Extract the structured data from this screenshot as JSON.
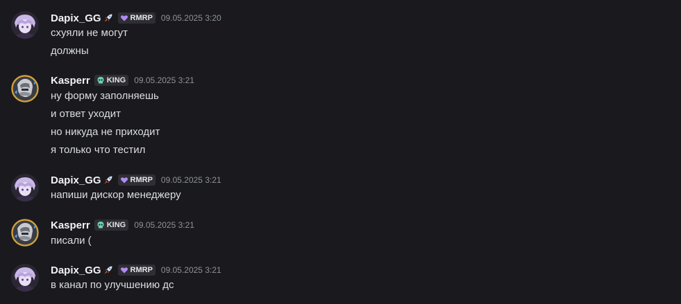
{
  "colors": {
    "background": "#1a1a1e",
    "username": "#f2f3f5",
    "message_text": "#dbdee1",
    "timestamp": "#8e9297",
    "tag_background": "#2e2e34",
    "rmrp_tag_icon": "#b08cf0",
    "king_tag_icon": "#6fd3b0"
  },
  "messages": [
    {
      "author": "Dapix_GG",
      "author_icon": "rocket-icon",
      "tag": "RMRP",
      "tag_icon": "purple-heart-icon",
      "timestamp": "09.05.2025 3:20",
      "lines": [
        "схуяли не могут",
        "должны"
      ]
    },
    {
      "author": "Kasperr",
      "tag": "KING",
      "tag_icon": "skull-icon",
      "timestamp": "09.05.2025 3:21",
      "lines": [
        "ну форму заполняешь",
        "и ответ уходит",
        "но никуда не приходит",
        "я только что тестил"
      ]
    },
    {
      "author": "Dapix_GG",
      "author_icon": "rocket-icon",
      "tag": "RMRP",
      "tag_icon": "purple-heart-icon",
      "timestamp": "09.05.2025 3:21",
      "lines": [
        "напиши дискор менеджеру"
      ]
    },
    {
      "author": "Kasperr",
      "tag": "KING",
      "tag_icon": "skull-icon",
      "timestamp": "09.05.2025 3:21",
      "lines": [
        "писали ("
      ]
    },
    {
      "author": "Dapix_GG",
      "author_icon": "rocket-icon",
      "tag": "RMRP",
      "tag_icon": "purple-heart-icon",
      "timestamp": "09.05.2025 3:21",
      "lines": [
        "в канал по улучшению дс"
      ]
    }
  ]
}
